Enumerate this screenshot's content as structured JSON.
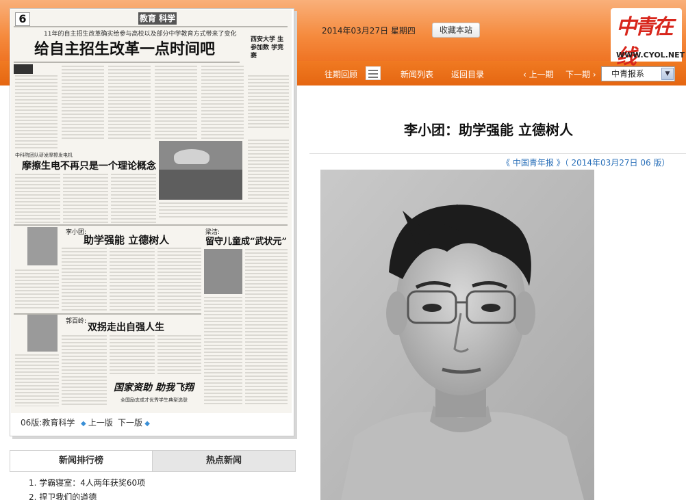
{
  "header": {
    "date": "2014年03月27日  星期四",
    "bookmark_label": "收藏本站",
    "logo_text": "中青在线",
    "logo_url": "WWW.CYOL.NET",
    "brand_color": "#ef7424"
  },
  "nav": {
    "history": "往期回顾",
    "news_list": "新闻列表",
    "back_to_index": "返回目录",
    "prev": "上一期",
    "next": "下一期",
    "paper_select": "中青报系"
  },
  "newspaper": {
    "page_label": "06版:教育科学",
    "prev_page": "上一版",
    "next_page": "下一版",
    "page_number": "6",
    "section_name": "教育 科学",
    "headline_top": "给自主招生改革一点时间吧",
    "subhead_top": "11年的自主招生改革确实给参与高校以及部分中学教育方式带来了变化",
    "side_headline": "西安大学 生参加数 学竞赛",
    "headline_mid": "摩擦生电不再只是一个理论概念",
    "feature_1_name": "李小团:",
    "feature_1_title": "助学强能 立德树人",
    "feature_2_name": "梁洁:",
    "feature_2_title": "留守儿童成“武状元”",
    "feature_3_name": "郭百岭:",
    "feature_3_title": "双拐走出自强人生",
    "bottom_slogan": "国家资助 助我飞翔",
    "bottom_caption": "全国励志成才优秀学生典型选登"
  },
  "article": {
    "title": "李小团：助学强能 立德树人",
    "meta": "《 中国青年报 》（ 2014年03月27日   06 版）"
  },
  "lists": {
    "tab_rank": "新闻排行榜",
    "tab_hot": "热点新闻",
    "items": [
      {
        "num": "1.",
        "text": "学霸寝室：4人两年获奖60项"
      },
      {
        "num": "2.",
        "text": "捍卫我们的道德"
      }
    ]
  }
}
